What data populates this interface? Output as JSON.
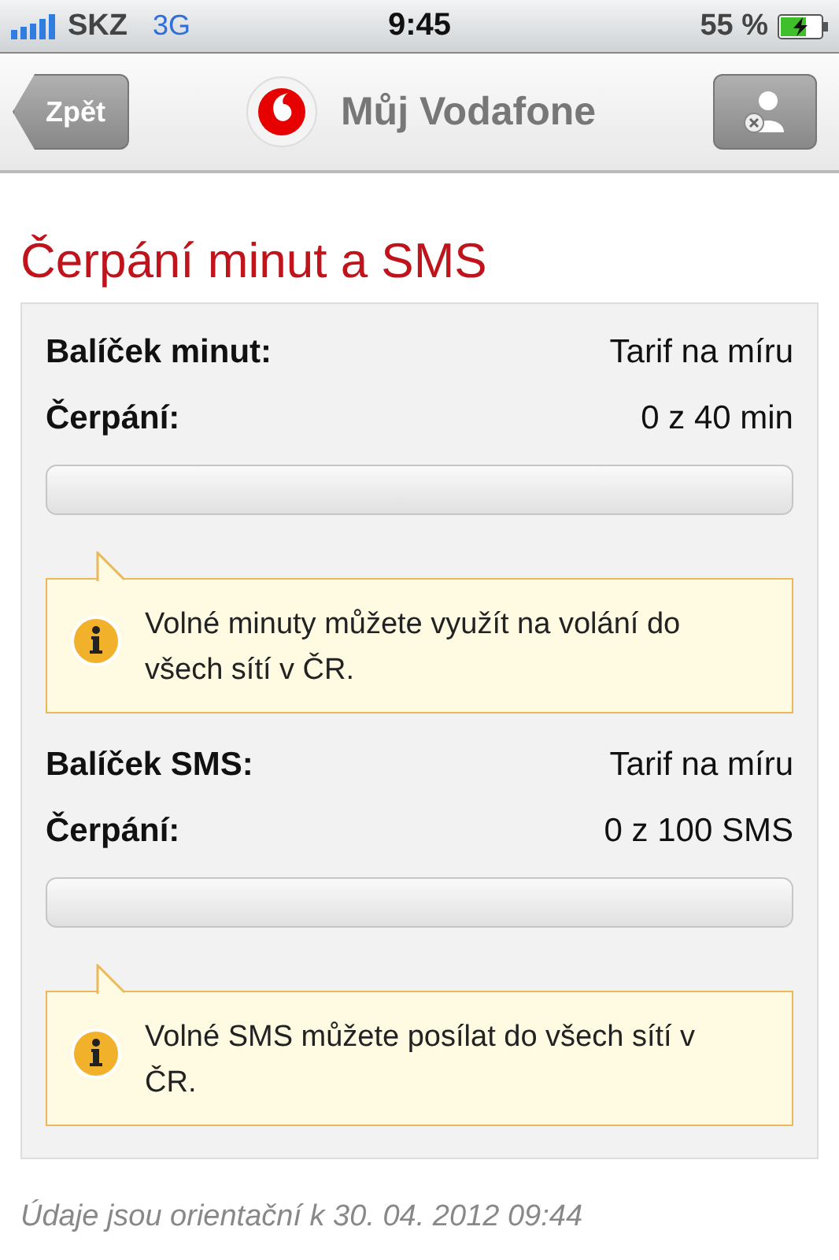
{
  "status_bar": {
    "carrier": "SKZ",
    "network": "3G",
    "time": "9:45",
    "battery": "55 %"
  },
  "nav_bar": {
    "back": "Zpět",
    "title": "Můj Vodafone"
  },
  "heading": "Čerpání minut a SMS",
  "sections": [
    {
      "rows": [
        {
          "label": "Balíček minut:",
          "value": "Tarif na míru"
        },
        {
          "label": "Čerpání:",
          "value": "0 z 40 min"
        }
      ],
      "level": 0,
      "info": "Volné minuty můžete využít na volání do všech sítí v ČR."
    },
    {
      "rows": [
        {
          "label": "Balíček SMS:",
          "value": "Tarif na míru"
        },
        {
          "label": "Čerpání:",
          "value": "0 z 100 SMS"
        }
      ],
      "level": 0,
      "info": "Volné SMS můžete posílat do všech sítí v ČR."
    }
  ],
  "footer": "Údaje jsou orientační k 30. 04. 2012 09:44"
}
